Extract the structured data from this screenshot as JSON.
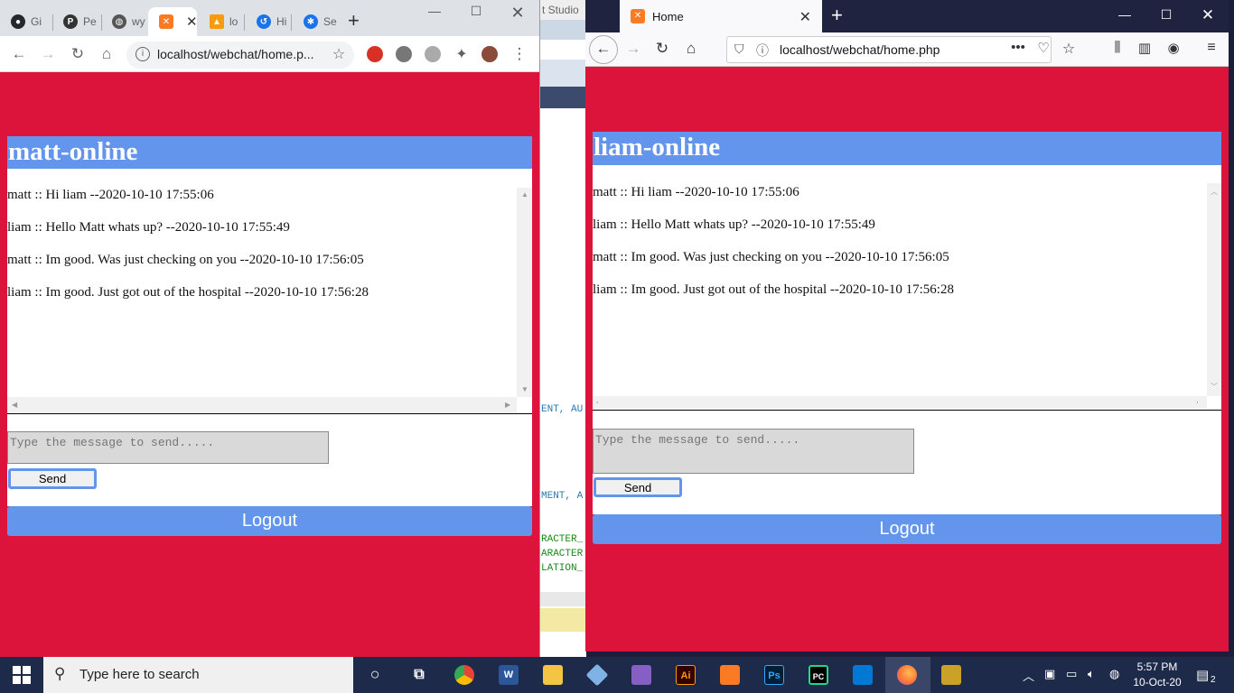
{
  "background_window": {
    "title_fragment": "t Studio",
    "code_lines": [
      {
        "text": "ENT, AU",
        "color": "#2a7ab0"
      },
      {
        "text": "MENT, A",
        "color": "#2a7ab0"
      },
      {
        "text": "RACTER_",
        "color": "#1a8a1a"
      },
      {
        "text": "ARACTER",
        "color": "#1a8a1a"
      },
      {
        "text": "LATION_",
        "color": "#1a8a1a"
      }
    ]
  },
  "chrome": {
    "tabs": [
      {
        "label": "Gi",
        "icon": "github-icon",
        "color": "#24292e"
      },
      {
        "label": "Pe",
        "icon": "pinterest-icon",
        "color": "#333"
      },
      {
        "label": "wy",
        "icon": "globe-icon",
        "color": "#555"
      },
      {
        "label": "",
        "icon": "xampp-icon",
        "color": "#fb7a24",
        "active": true
      },
      {
        "label": "lo",
        "icon": "phpmyadmin-icon",
        "color": "#f89c0e"
      },
      {
        "label": "Hi",
        "icon": "history-icon",
        "color": "#1a73e8"
      },
      {
        "label": "Se",
        "icon": "settings-icon",
        "color": "#1a73e8"
      }
    ],
    "url": "localhost/webchat/home.p...",
    "chat": {
      "header": "matt-online",
      "messages": [
        "matt :: Hi liam --2020-10-10 17:55:06",
        "liam :: Hello Matt whats up? --2020-10-10 17:55:49",
        "matt :: Im good. Was just checking on you --2020-10-10 17:56:05",
        "liam :: Im good. Just got out of the hospital --2020-10-10 17:56:28"
      ],
      "input_placeholder": "Type the message to send.....",
      "send_label": "Send",
      "logout_label": "Logout"
    }
  },
  "firefox": {
    "tab_title": "Home",
    "url": "localhost/webchat/home.php",
    "chat": {
      "header": "liam-online",
      "messages": [
        "matt :: Hi liam --2020-10-10 17:55:06",
        "liam :: Hello Matt whats up? --2020-10-10 17:55:49",
        "matt :: Im good. Was just checking on you --2020-10-10 17:56:05",
        "liam :: Im good. Just got out of the hospital --2020-10-10 17:56:28"
      ],
      "input_placeholder": "Type the message to send.....",
      "send_label": "Send",
      "logout_label": "Logout"
    }
  },
  "taskbar": {
    "search_placeholder": "Type here to search",
    "time": "5:57 PM",
    "date": "10-Oct-20",
    "notification_count": "2",
    "apps": [
      {
        "name": "cortana",
        "glyph": "○",
        "color": "transparent"
      },
      {
        "name": "task-view",
        "glyph": "⧉",
        "color": "transparent"
      },
      {
        "name": "chrome",
        "glyph": "",
        "color": "#4285f4"
      },
      {
        "name": "word",
        "glyph": "W",
        "color": "#2b579a"
      },
      {
        "name": "file-explorer",
        "glyph": "",
        "color": "#f4c542"
      },
      {
        "name": "3d-viewer",
        "glyph": "",
        "color": "#7fb2e5"
      },
      {
        "name": "visual-studio",
        "glyph": "",
        "color": "#865fc5"
      },
      {
        "name": "illustrator",
        "glyph": "Ai",
        "color": "#330000"
      },
      {
        "name": "xampp",
        "glyph": "",
        "color": "#fb7a24"
      },
      {
        "name": "photoshop",
        "glyph": "Ps",
        "color": "#001e36"
      },
      {
        "name": "pycharm",
        "glyph": "PC",
        "color": "#21d789"
      },
      {
        "name": "vscode",
        "glyph": "",
        "color": "#0078d4"
      },
      {
        "name": "firefox",
        "glyph": "",
        "color": "#ff7139"
      },
      {
        "name": "tools",
        "glyph": "",
        "color": "#c9a227"
      }
    ]
  }
}
